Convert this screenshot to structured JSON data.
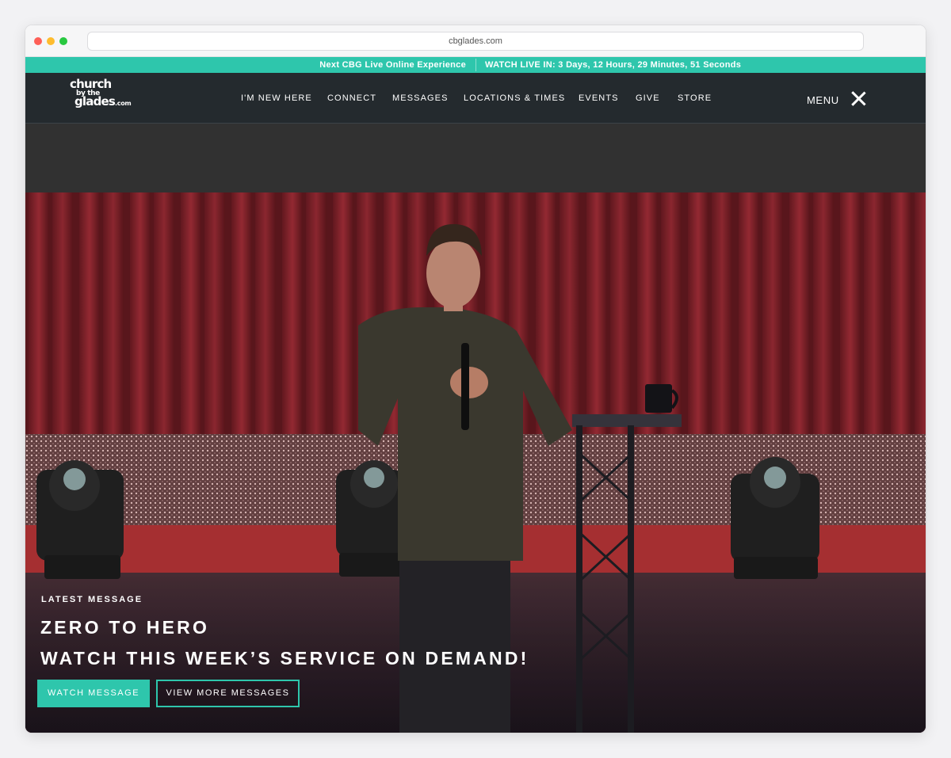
{
  "browser": {
    "url": "cbglades.com"
  },
  "announcement": {
    "left_text": "Next CBG Live Online Experience",
    "right_text": "WATCH LIVE IN: 3 Days, 12 Hours, 29 Minutes, 51 Seconds"
  },
  "header": {
    "logo": {
      "line1": "church",
      "line2": "by the",
      "line3": "glades",
      "line3_suffix": ".com"
    },
    "nav_items": [
      {
        "label": "I'M NEW HERE"
      },
      {
        "label": "CONNECT"
      },
      {
        "label": "MESSAGES"
      },
      {
        "label": "LOCATIONS & TIMES"
      },
      {
        "label": "EVENTS"
      },
      {
        "label": "GIVE"
      },
      {
        "label": "STORE"
      }
    ],
    "menu_label": "MENU",
    "menu_icon": "close-icon"
  },
  "hero": {
    "eyebrow": "LATEST MESSAGE",
    "title": "ZERO TO HERO",
    "subtitle": "WATCH THIS WEEK’S SERVICE ON DEMAND!",
    "primary_button": "WATCH MESSAGE",
    "secondary_button": "VIEW MORE MESSAGES",
    "colors": {
      "accent": "#2ec6ac",
      "nav_bg": "#242a2e",
      "curtain": "#a3303a"
    }
  }
}
